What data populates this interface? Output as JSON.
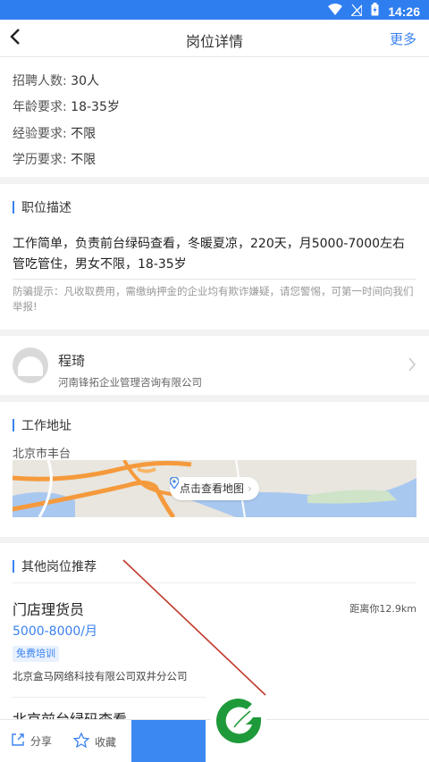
{
  "status_bar": {
    "time": "14:26",
    "icons": [
      "wifi-icon",
      "sim-icon",
      "battery-icon"
    ]
  },
  "header": {
    "title": "岗位详情",
    "back_icon": "back-chevron-icon",
    "more_label": "更多"
  },
  "requirements": [
    {
      "label": "招聘人数:",
      "value": "30人"
    },
    {
      "label": "年龄要求:",
      "value": "18-35岁"
    },
    {
      "label": "经验要求:",
      "value": "不限"
    },
    {
      "label": "学历要求:",
      "value": "不限"
    }
  ],
  "description": {
    "heading": "职位描述",
    "text_line1": "工作简单，负责前台绿码查看，冬暖夏凉，220天，月5000-7000左右",
    "text_line2": "管吃管住，男女不限，18-35岁",
    "warning": "防骗提示：凡收取费用，需缴纳押金的企业均有欺诈嫌疑，请您警惕，可第一时间向我们举报!"
  },
  "contact": {
    "name": "程琦",
    "company": "河南锋拓企业管理咨询有限公司"
  },
  "work_address": {
    "heading": "工作地址",
    "city": "北京市丰台",
    "map_button": "点击查看地图"
  },
  "other_jobs": {
    "heading": "其他岗位推荐",
    "items": [
      {
        "title": "门店理货员",
        "distance": "距离你12.9km",
        "salary": "5000-8000/月",
        "tag": "免费培训",
        "company": "北京盒马网络科技有限公司双井分公司"
      },
      {
        "title": "北京前台绿码查看"
      }
    ]
  },
  "bottom_bar": {
    "share_label": "分享",
    "favorite_label": "收藏"
  },
  "colors": {
    "accent": "#3a82f0",
    "status_bar": "#2f7ef0",
    "logo_green": "#1f9a3a",
    "annotation_red": "#c0392b"
  }
}
